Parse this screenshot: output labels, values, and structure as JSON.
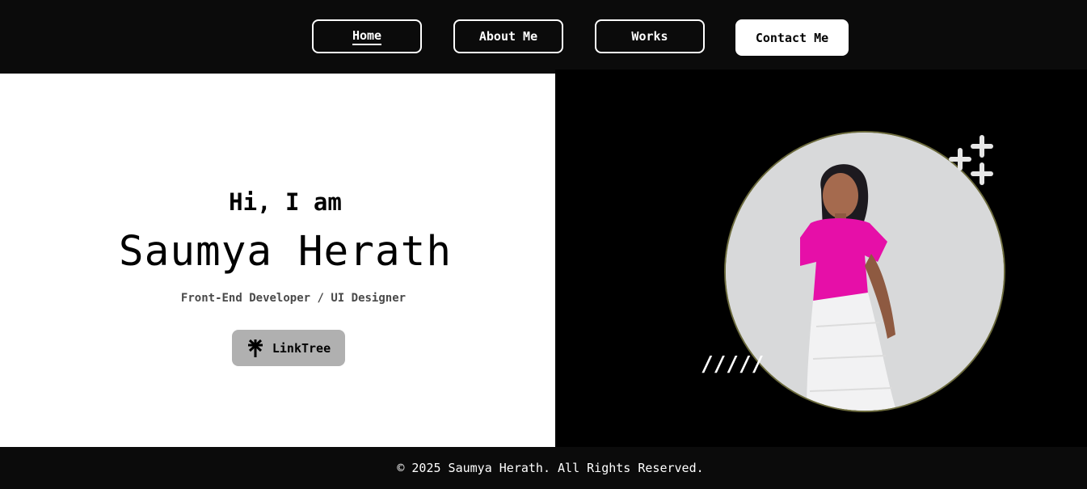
{
  "nav": {
    "items": [
      {
        "label": "Home",
        "active": true
      },
      {
        "label": "About Me"
      },
      {
        "label": "Works"
      },
      {
        "label": "Contact Me",
        "highlighted": true
      }
    ]
  },
  "hero": {
    "greeting": "Hi, I am",
    "name": "Saumya Herath",
    "role": "Front-End Developer / UI Designer",
    "linktree_label": "LinkTree",
    "linktree_icon": "linktree-asterisk-icon",
    "decor_slashes": "/////"
  },
  "footer": {
    "copyright": "© 2025 Saumya Herath. All Rights Reserved."
  },
  "colors": {
    "background_dark": "#0b0b0b",
    "hero_left_bg": "#ffffff",
    "hero_right_bg": "#000000",
    "linktree_bg": "#b0b0b0",
    "portrait_border": "#6b6a3c"
  }
}
